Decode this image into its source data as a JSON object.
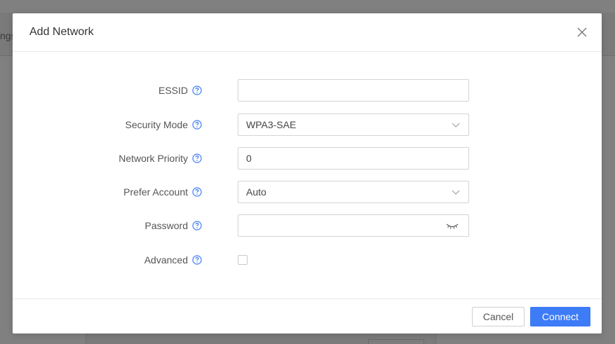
{
  "background": {
    "tab_fragment": "ngs"
  },
  "dialog": {
    "title": "Add Network",
    "close_icon": "close-icon",
    "fields": {
      "essid": {
        "label": "ESSID",
        "value": ""
      },
      "security_mode": {
        "label": "Security Mode",
        "value": "WPA3-SAE"
      },
      "network_priority": {
        "label": "Network Priority",
        "value": "0"
      },
      "prefer_account": {
        "label": "Prefer Account",
        "value": "Auto"
      },
      "password": {
        "label": "Password",
        "value": ""
      },
      "advanced": {
        "label": "Advanced",
        "checked": false
      }
    },
    "buttons": {
      "cancel": "Cancel",
      "connect": "Connect"
    }
  },
  "colors": {
    "accent": "#3d7bf7",
    "help_icon": "#3d7bf7",
    "overlay": "#808080"
  }
}
